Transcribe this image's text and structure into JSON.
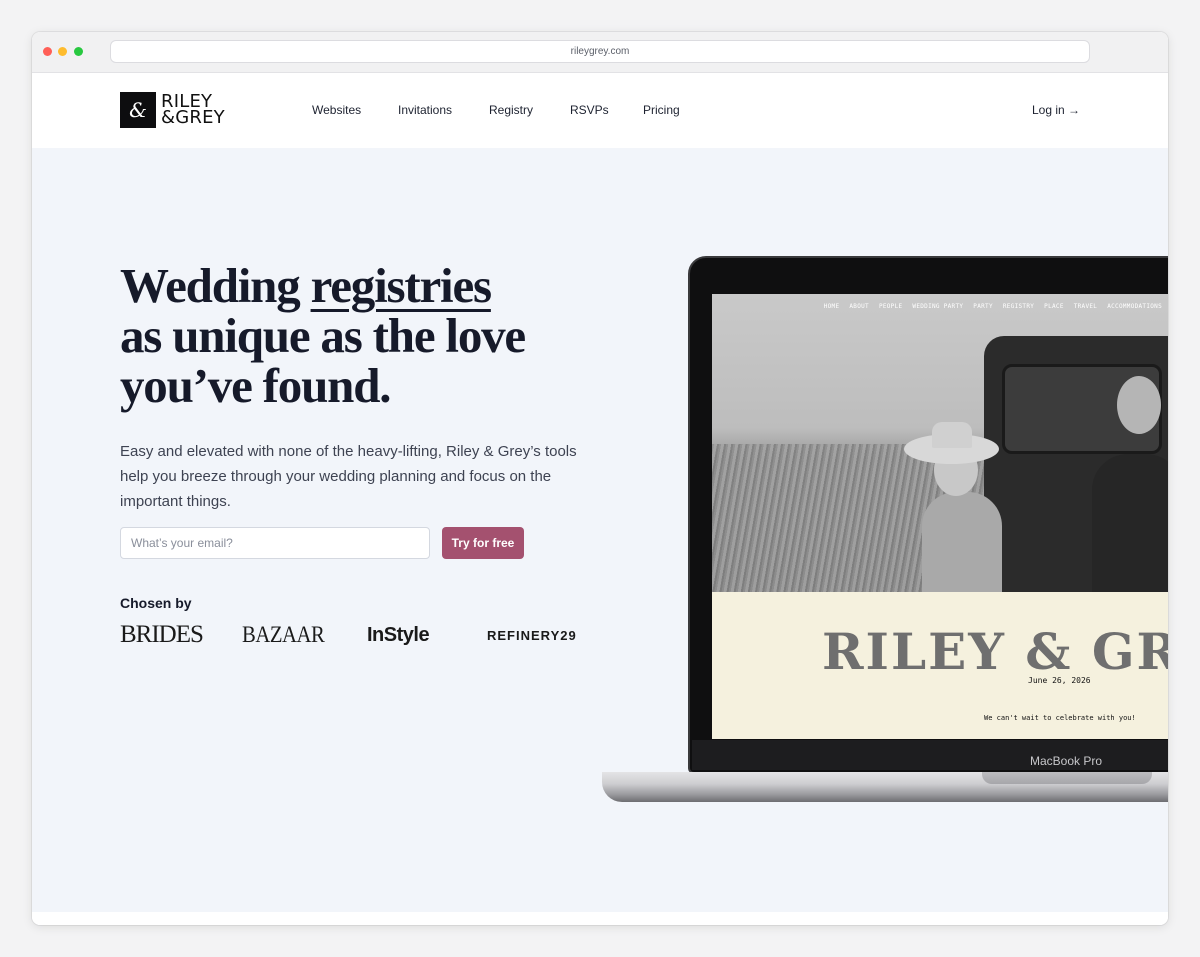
{
  "browser": {
    "url": "rileygrey.com"
  },
  "nav": {
    "logo_mark": "&",
    "logo_line1": "RILEY",
    "logo_line2": "&GREY",
    "items": [
      "Websites",
      "Invitations",
      "Registry",
      "RSVPs",
      "Pricing"
    ],
    "login": "Log in →"
  },
  "hero": {
    "headline_line1_a": "Wedding ",
    "headline_line1_b": "registries",
    "headline_line2": "as unique as the love",
    "headline_line3": "you’ve found.",
    "subtext": "Easy and elevated with none of the heavy-lifting, Riley & Grey’s tools help you breeze through your wedding planning and focus on the important things.",
    "email_placeholder": "What’s your email?",
    "cta": "Try for free",
    "chosen_by": "Chosen by",
    "press": [
      "BRIDES",
      "BAZAAR",
      "InStyle",
      "REFINERY29"
    ]
  },
  "laptop": {
    "site_nav": [
      "HOME",
      "ABOUT",
      "PEOPLE",
      "WEDDING PARTY",
      "PARTY",
      "REGISTRY",
      "PLACE",
      "TRAVEL",
      "ACCOMMODATIONS"
    ],
    "site_title": "RILEY & GREY",
    "site_date": "June 26, 2026",
    "site_tagline": "We can't wait to celebrate with you!",
    "model_label": "MacBook Pro"
  }
}
